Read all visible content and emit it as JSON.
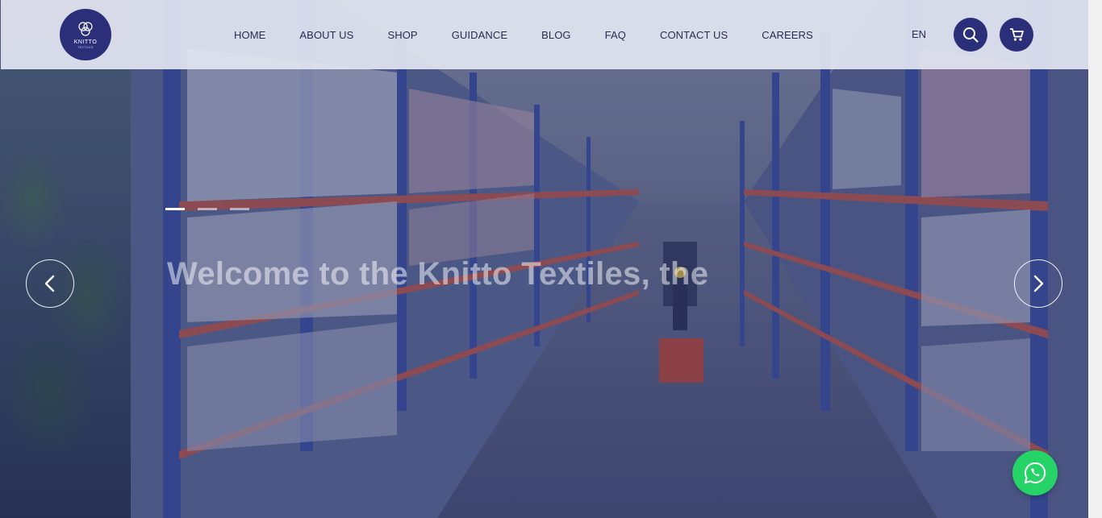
{
  "header": {
    "logo_text": "KNITTO",
    "logo_subtext": "TEXTILES",
    "nav": [
      "HOME",
      "ABOUT US",
      "SHOP",
      "GUIDANCE",
      "BLOG",
      "FAQ",
      "CONTACT US",
      "CAREERS"
    ],
    "language": "EN",
    "search_icon": "search-icon",
    "cart_icon": "cart-icon"
  },
  "hero": {
    "headline": "Welcome to the Knitto Textiles, the",
    "subline": "",
    "slides": 3,
    "active_slide": 1,
    "prev_icon": "chevron-left-icon",
    "next_icon": "chevron-right-icon"
  },
  "whatsapp": {
    "icon": "whatsapp-icon"
  },
  "colors": {
    "brand": "#2b2f7a",
    "header_bg": "#e2e4f0",
    "nav_text": "#2a2d52",
    "whatsapp": "#25d366"
  }
}
